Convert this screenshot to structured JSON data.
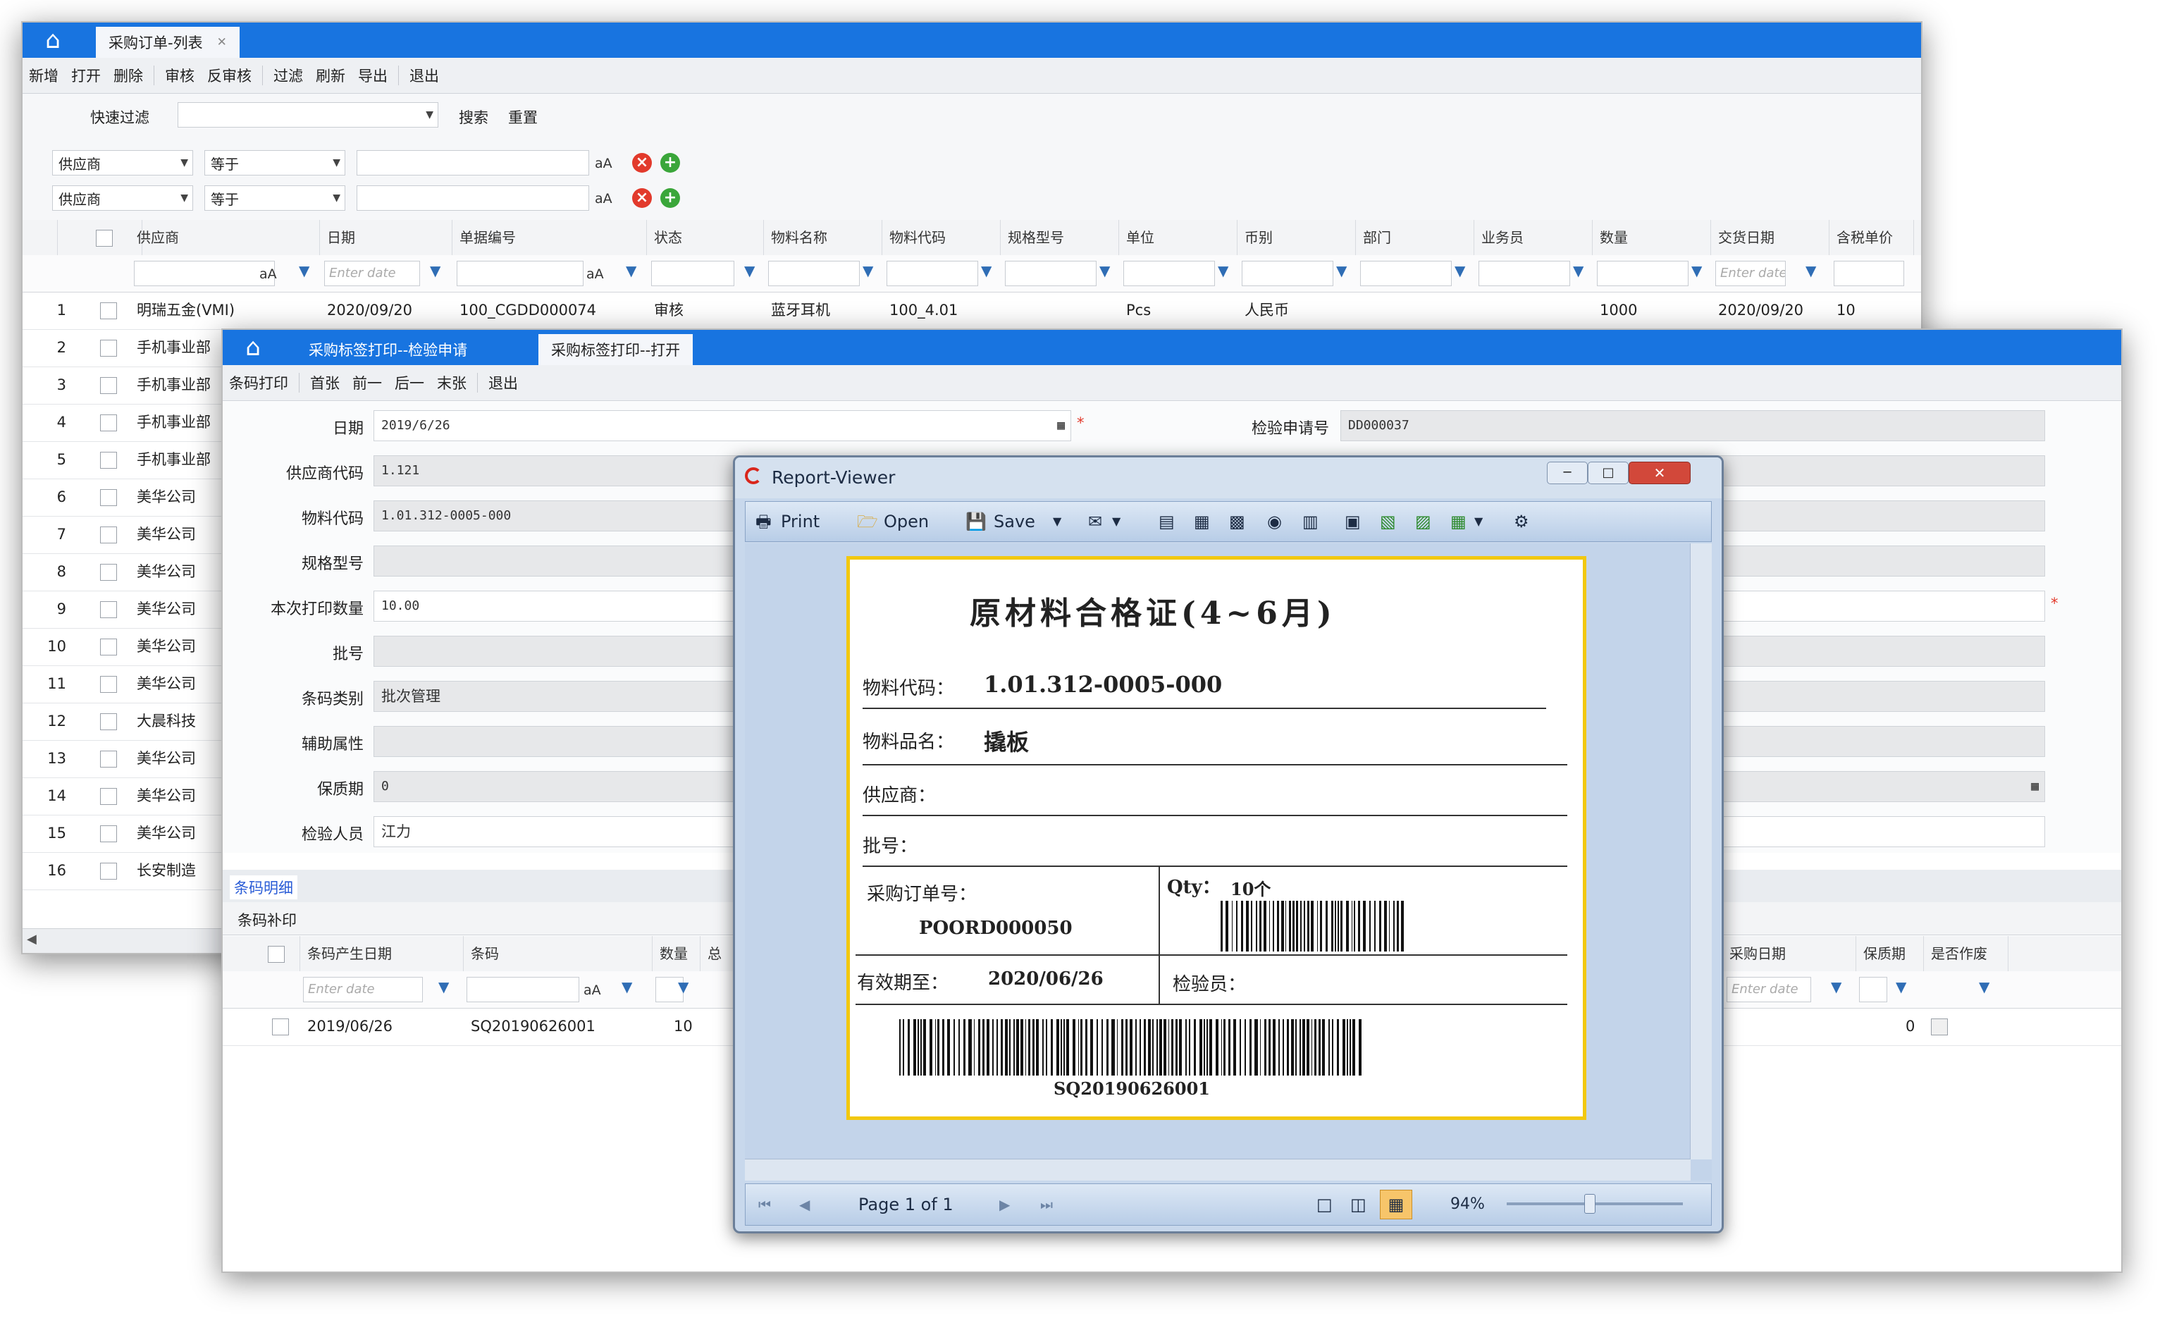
{
  "list_window": {
    "tab_title": "采购订单-列表",
    "toolbar": [
      "新增",
      "打开",
      "删除",
      "审核",
      "反审核",
      "过滤",
      "刷新",
      "导出",
      "退出"
    ],
    "quick_filter_label": "快速过滤",
    "search_label": "搜索",
    "reset_label": "重置",
    "filter_rows": [
      {
        "field": "供应商",
        "op": "等于"
      },
      {
        "field": "供应商",
        "op": "等于"
      }
    ],
    "aa": "aA",
    "columns": [
      "供应商",
      "日期",
      "单据编号",
      "状态",
      "物料名称",
      "物料代码",
      "规格型号",
      "单位",
      "币别",
      "部门",
      "业务员",
      "数量",
      "交货日期",
      "含税单价"
    ],
    "date_placeholder": "Enter date",
    "rows": [
      {
        "no": "1",
        "supplier": "明瑞五金(VMI)",
        "date": "2020/09/20",
        "bill": "100_CGDD000074",
        "status": "审核",
        "mat": "蓝牙耳机",
        "code": "100_4.01",
        "unit": "Pcs",
        "currency": "人民币",
        "qty": "1000",
        "delivery": "2020/09/20",
        "price": "10"
      },
      {
        "no": "2",
        "supplier": "手机事业部"
      },
      {
        "no": "3",
        "supplier": "手机事业部"
      },
      {
        "no": "4",
        "supplier": "手机事业部"
      },
      {
        "no": "5",
        "supplier": "手机事业部"
      },
      {
        "no": "6",
        "supplier": "美华公司"
      },
      {
        "no": "7",
        "supplier": "美华公司"
      },
      {
        "no": "8",
        "supplier": "美华公司"
      },
      {
        "no": "9",
        "supplier": "美华公司"
      },
      {
        "no": "10",
        "supplier": "美华公司"
      },
      {
        "no": "11",
        "supplier": "美华公司"
      },
      {
        "no": "12",
        "supplier": "大晨科技"
      },
      {
        "no": "13",
        "supplier": "美华公司"
      },
      {
        "no": "14",
        "supplier": "美华公司"
      },
      {
        "no": "15",
        "supplier": "美华公司"
      },
      {
        "no": "16",
        "supplier": "长安制造"
      }
    ]
  },
  "label_window": {
    "tabs": [
      "采购标签打印--检验申请",
      "采购标签打印--打开"
    ],
    "toolbar": [
      "条码打印",
      "首张",
      "前一",
      "后一",
      "末张",
      "退出"
    ],
    "form": {
      "date_label": "日期",
      "date_value": "2019/6/26",
      "inspect_no_label": "检验申请号",
      "inspect_no_value": "DD000037",
      "supplier_code_label": "供应商代码",
      "supplier_code_value": "1.121",
      "material_code_label": "物料代码",
      "material_code_value": "1.01.312-0005-000",
      "spec_label": "规格型号",
      "spec_value": "",
      "print_qty_label": "本次打印数量",
      "print_qty_value": "10.00",
      "batch_label": "批号",
      "batch_value": "",
      "barcode_type_label": "条码类别",
      "barcode_type_value": "批次管理",
      "aux_label": "辅助属性",
      "aux_value": "",
      "shelf_label": "保质期",
      "shelf_value": "0",
      "inspector_label": "检验人员",
      "inspector_value": "江力"
    },
    "detail_tab": "条码明细",
    "detail_action": "条码补印",
    "detail_columns": [
      "条码产生日期",
      "条码",
      "数量",
      "总",
      "采购日期",
      "保质期",
      "是否作废"
    ],
    "detail_row": {
      "date": "2019/06/26",
      "barcode": "SQ20190626001",
      "qty": "10",
      "shelf": "0"
    }
  },
  "report_viewer": {
    "title": "Report-Viewer",
    "toolbar": {
      "print": "Print",
      "open": "Open",
      "save": "Save"
    },
    "status": {
      "page": "Page 1 of 1",
      "zoom": "94%"
    },
    "cert": {
      "title": "原材料合格证(4~6月)",
      "material_code_label": "物料代码：",
      "material_code": "1.01.312-0005-000",
      "material_name_label": "物料品名：",
      "material_name": "撬板",
      "supplier_label": "供应商：",
      "batch_label": "批号：",
      "po_label": "采购订单号：",
      "po_value": "POORD000050",
      "qty_label": "Qty：",
      "qty_value": "10个",
      "expiry_label": "有效期至：",
      "expiry_value": "2020/06/26",
      "inspector_label": "检验员：",
      "barcode_text": "SQ20190626001"
    }
  },
  "colors": {
    "tab_blue": "#1874e0",
    "cert_border": "#f2c80f",
    "close_red": "#e23a2c",
    "add_green": "#3aa63a"
  }
}
